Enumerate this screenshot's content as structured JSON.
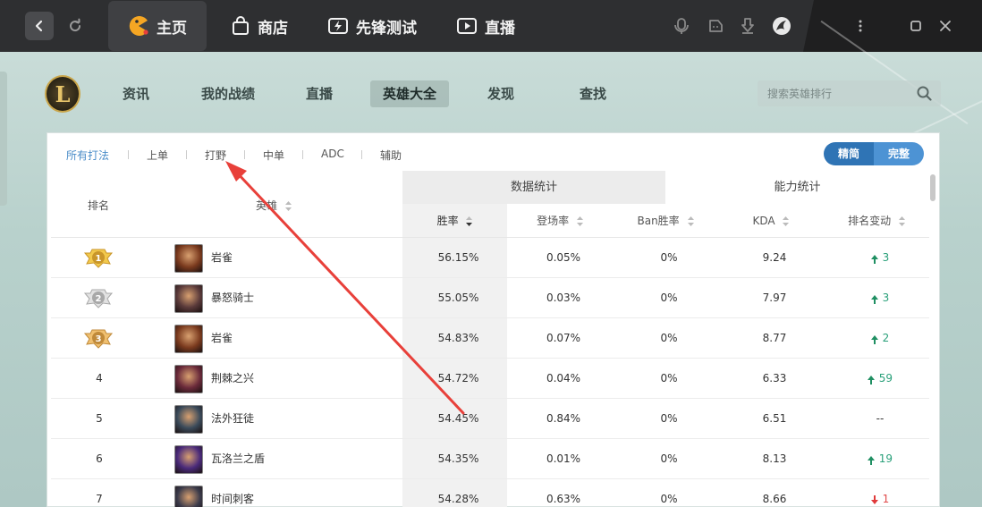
{
  "topbar": {
    "tabs": [
      {
        "label": "主页",
        "icon": "pacman-logo-icon"
      },
      {
        "label": "商店",
        "icon": "bag-icon"
      },
      {
        "label": "先锋测试",
        "icon": "lightning-ticket-icon"
      },
      {
        "label": "直播",
        "icon": "play-icon"
      }
    ]
  },
  "subnav": {
    "items": [
      "资讯",
      "我的战绩",
      "直播",
      "英雄大全",
      "发现",
      "查找"
    ],
    "active_index": 3,
    "logo_text": "L"
  },
  "search": {
    "placeholder": "搜索英雄排行"
  },
  "filters": {
    "items": [
      "所有打法",
      "上单",
      "打野",
      "中单",
      "ADC",
      "辅助"
    ],
    "active_index": 0
  },
  "view_toggle": {
    "simple": "精简",
    "full": "完整"
  },
  "table": {
    "group_headers": [
      "数据统计",
      "能力统计"
    ],
    "headers": {
      "rank": "排名",
      "hero": "英雄",
      "winrate": "胜率",
      "pickrate": "登场率",
      "banwin": "Ban胜率",
      "kda": "KDA",
      "change": "排名变动"
    },
    "rows": [
      {
        "rank": "1",
        "medal": "gold",
        "hero": "岩雀",
        "winrate": "56.15%",
        "pickrate": "0.05%",
        "banwin": "0%",
        "kda": "9.24",
        "change": "3",
        "dir": "up",
        "avatar_color": "#7a3a1e"
      },
      {
        "rank": "2",
        "medal": "silver",
        "hero": "暴怒骑士",
        "winrate": "55.05%",
        "pickrate": "0.03%",
        "banwin": "0%",
        "kda": "7.97",
        "change": "3",
        "dir": "up",
        "avatar_color": "#5a3a3a"
      },
      {
        "rank": "3",
        "medal": "bronze",
        "hero": "岩雀",
        "winrate": "54.83%",
        "pickrate": "0.07%",
        "banwin": "0%",
        "kda": "8.77",
        "change": "2",
        "dir": "up",
        "avatar_color": "#7a3a1e"
      },
      {
        "rank": "4",
        "medal": "",
        "hero": "荆棘之兴",
        "winrate": "54.72%",
        "pickrate": "0.04%",
        "banwin": "0%",
        "kda": "6.33",
        "change": "59",
        "dir": "up",
        "avatar_color": "#6a2a3a"
      },
      {
        "rank": "5",
        "medal": "",
        "hero": "法外狂徒",
        "winrate": "54.45%",
        "pickrate": "0.84%",
        "banwin": "0%",
        "kda": "6.51",
        "change": "--",
        "dir": "none",
        "avatar_color": "#3a4a5a"
      },
      {
        "rank": "6",
        "medal": "",
        "hero": "瓦洛兰之盾",
        "winrate": "54.35%",
        "pickrate": "0.01%",
        "banwin": "0%",
        "kda": "8.13",
        "change": "19",
        "dir": "up",
        "avatar_color": "#4a2a7a"
      },
      {
        "rank": "7",
        "medal": "",
        "hero": "时间刺客",
        "winrate": "54.28%",
        "pickrate": "0.63%",
        "banwin": "0%",
        "kda": "8.66",
        "change": "1",
        "dir": "down",
        "avatar_color": "#3a3a4a"
      }
    ]
  },
  "colors": {
    "accent": "#4a8cc8",
    "toggle_active": "#2f74b5",
    "toggle_inactive": "#4d93d4",
    "rank_up": "#2aa07a",
    "rank_down": "#e04a4a",
    "annotation_arrow": "#e8403a"
  }
}
